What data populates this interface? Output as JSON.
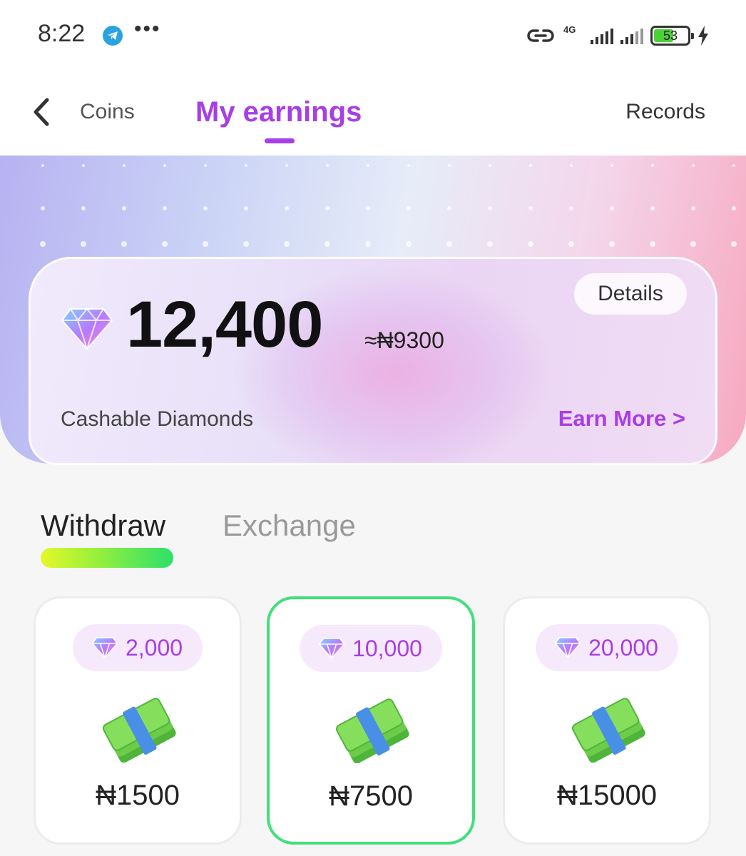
{
  "status": {
    "time": "8:22",
    "dots": "•••",
    "network": "4G",
    "battery": "53"
  },
  "header": {
    "back_icon": "chevron-left-icon",
    "tab_coins": "Coins",
    "tab_earnings": "My earnings",
    "records": "Records"
  },
  "balance": {
    "diamonds": "12,400",
    "approx": "≈₦9300",
    "details": "Details",
    "label": "Cashable Diamonds",
    "earn_more": "Earn More >"
  },
  "tabs": {
    "withdraw": "Withdraw",
    "exchange": "Exchange"
  },
  "options": [
    {
      "diamonds": "2,000",
      "price": "₦1500",
      "selected": false
    },
    {
      "diamonds": "10,000",
      "price": "₦7500",
      "selected": true
    },
    {
      "diamonds": "20,000",
      "price": "₦15000",
      "selected": false
    }
  ],
  "colors": {
    "accent": "#a73ee6",
    "selected_border": "#41e07d"
  }
}
